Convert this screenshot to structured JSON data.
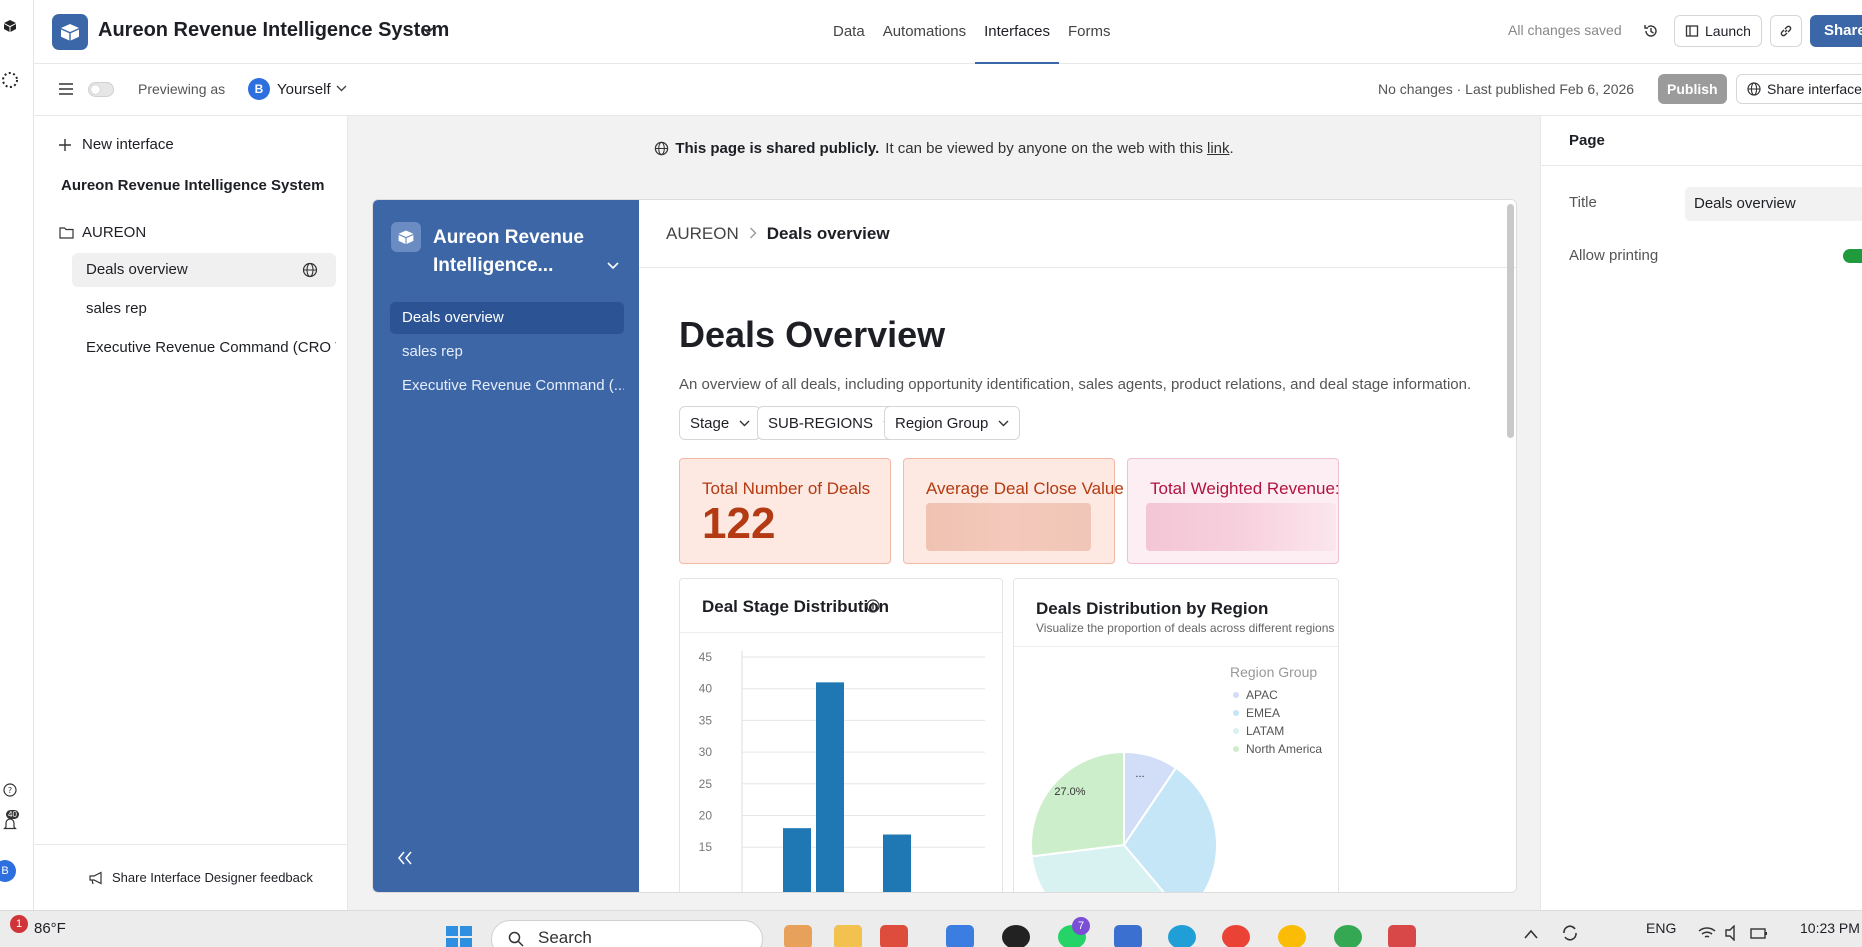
{
  "topbar": {
    "app_title": "Aureon Revenue Intelligence System",
    "tabs": [
      {
        "label": "Data"
      },
      {
        "label": "Automations"
      },
      {
        "label": "Interfaces"
      },
      {
        "label": "Forms"
      }
    ],
    "active_tab": "Interfaces",
    "saved_status": "All changes saved",
    "launch_label": "Launch",
    "share_label": "Share"
  },
  "subbar": {
    "previewing_label": "Previewing as",
    "avatar_initial": "B",
    "user_label": "Yourself",
    "publish_status": "No changes · Last published Feb 6, 2026",
    "publish_label": "Publish",
    "share_interface_label": "Share interface"
  },
  "sidebar": {
    "new_interface": "New interface",
    "base_title": "Aureon Revenue Intelligence System",
    "folder": "AUREON",
    "pages": [
      {
        "label": "Deals overview"
      },
      {
        "label": "sales rep"
      },
      {
        "label": "Executive Revenue Command (CRO V"
      }
    ],
    "feedback": "Share Interface Designer feedback"
  },
  "banner": {
    "bold": "This page is shared publicly.",
    "text": "It can be viewed by anyone on the web with this",
    "link": "link",
    "end": "."
  },
  "interface": {
    "name": "Aureon Revenue Intelligence...",
    "nav": [
      {
        "label": "Deals overview"
      },
      {
        "label": "sales rep"
      },
      {
        "label": "Executive Revenue Command (..."
      }
    ],
    "breadcrumb": {
      "root": "AUREON",
      "current": "Deals overview"
    },
    "title": "Deals Overview",
    "description": "An overview of all deals, including opportunity identification, sales agents, product relations, and deal stage information.",
    "filters": [
      {
        "label": "Stage"
      },
      {
        "label": "SUB-REGIONS"
      },
      {
        "label": "Region Group"
      }
    ],
    "kpis": [
      {
        "label": "Total Number of Deals",
        "value": "122",
        "color": "#b33a12",
        "bg": "#fde9e2",
        "border": "#f2b9a4"
      },
      {
        "label": "Average Deal Close Value",
        "value": "",
        "color": "#b33a12",
        "bg": "#fde9e2",
        "border": "#f2b9a4"
      },
      {
        "label": "Total Weighted Revenue:",
        "value": "",
        "color": "#b2123f",
        "bg": "#fdeef4",
        "border": "#f0bfd0"
      }
    ],
    "bar_panel": {
      "title": "Deal Stage Distribution"
    },
    "pie_panel": {
      "title": "Deals Distribution by Region",
      "subtitle": "Visualize the proportion of deals across different regions",
      "legend_title": "Region Group",
      "slice_label_1": "27.0%",
      "slice_label_2": "..."
    }
  },
  "chart_data": [
    {
      "type": "bar",
      "title": "Deal Stage Distribution",
      "y_ticks": [
        "45",
        "40",
        "35",
        "30",
        "25",
        "20",
        "15"
      ],
      "ylim": [
        15,
        45
      ],
      "grid": true,
      "values": [
        18,
        41,
        17
      ],
      "bar_color": "#1f77b4"
    },
    {
      "type": "pie",
      "title": "Deals Distribution by Region",
      "legend_title": "Region Group",
      "legend_position": "top-right",
      "categories": [
        "APAC",
        "EMEA",
        "LATAM",
        "North America"
      ],
      "slice_colors": [
        "#d2ddf7",
        "#c5e6f7",
        "#d8f1f1",
        "#cdeecb"
      ],
      "visible_labels": [
        "27.0%",
        "..."
      ]
    }
  ],
  "right_panel": {
    "header": "Page",
    "title_label": "Title",
    "title_value": "Deals overview",
    "allow_printing_label": "Allow printing",
    "allow_printing": true
  },
  "taskbar": {
    "temperature": "86°F",
    "notification_count": "1",
    "search_placeholder": "Search",
    "whatsapp_badge": "7",
    "language": "ENG",
    "time": "10:23 PM"
  },
  "rail": {
    "badge_count": "40",
    "avatar_initial": "B"
  }
}
